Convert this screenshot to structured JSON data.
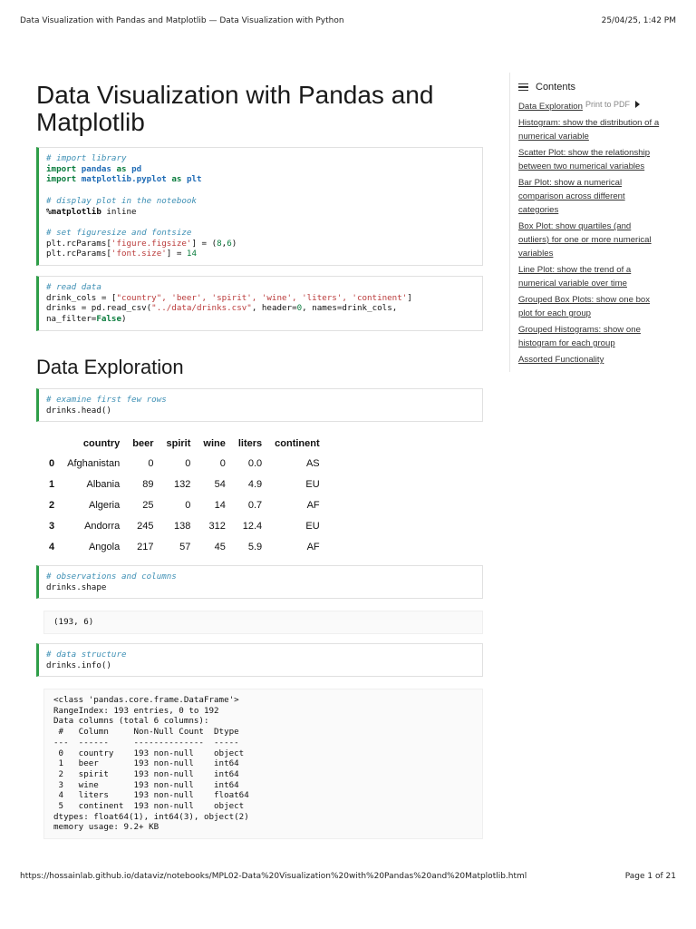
{
  "header": {
    "title": "Data Visualization with Pandas and Matplotlib — Data Visualization with Python",
    "datetime": "25/04/25, 1:42 PM"
  },
  "footer": {
    "url": "https://hossainlab.github.io/dataviz/notebooks/MPL02-Data%20Visualization%20with%20Pandas%20and%20Matplotlib.html",
    "page": "Page 1 of 21"
  },
  "page_title": "Data Visualization with Pandas and Matplotlib",
  "section_title": "Data Exploration",
  "cells": {
    "c1": {
      "comment1": "# import library",
      "kw_import": "import",
      "mod_pandas": "pandas",
      "kw_as": "as",
      "alias_pd": "pd",
      "mod_pyplot": "matplotlib.pyplot",
      "alias_plt": "plt",
      "comment2": "# display plot in the notebook",
      "magic": "%matplotlib",
      "magic_arg": " inline",
      "comment3": "# set figuresize and fontsize",
      "rc1_pre": "plt.rcParams[",
      "rc1_key": "'figure.figsize'",
      "rc1_mid": "] = (",
      "rc1_v1": "8",
      "rc1_comma": ",",
      "rc1_v2": "6",
      "rc1_end": ")",
      "rc2_pre": "plt.rcParams[",
      "rc2_key": "'font.size'",
      "rc2_mid": "] = ",
      "rc2_val": "14"
    },
    "c2": {
      "comment": "# read data",
      "line1_pre": "drink_cols = [",
      "line1_strings": "\"country\", 'beer', 'spirit', 'wine', 'liters', 'continent'",
      "line1_end": "]",
      "line2_pre": "drinks = pd.read_csv(",
      "line2_path": "\"../data/drinks.csv\"",
      "line2_mid": ", header=",
      "line2_zero": "0",
      "line2_end": ", names=drink_cols,",
      "line3_pre": "na_filter=",
      "line3_false": "False",
      "line3_end": ")"
    },
    "c3": {
      "comment": "# examine first few rows",
      "code": "drinks.head()"
    },
    "c4": {
      "comment": "# observations and columns",
      "code": "drinks.shape"
    },
    "c5": {
      "comment": "# data structure",
      "code": "drinks.info()"
    }
  },
  "table": {
    "columns": [
      "country",
      "beer",
      "spirit",
      "wine",
      "liters",
      "continent"
    ],
    "rows": [
      {
        "idx": "0",
        "cells": [
          "Afghanistan",
          "0",
          "0",
          "0",
          "0.0",
          "AS"
        ]
      },
      {
        "idx": "1",
        "cells": [
          "Albania",
          "89",
          "132",
          "54",
          "4.9",
          "EU"
        ]
      },
      {
        "idx": "2",
        "cells": [
          "Algeria",
          "25",
          "0",
          "14",
          "0.7",
          "AF"
        ]
      },
      {
        "idx": "3",
        "cells": [
          "Andorra",
          "245",
          "138",
          "312",
          "12.4",
          "EU"
        ]
      },
      {
        "idx": "4",
        "cells": [
          "Angola",
          "217",
          "57",
          "45",
          "5.9",
          "AF"
        ]
      }
    ]
  },
  "shape_output": "(193, 6)",
  "info_output": [
    "<class 'pandas.core.frame.DataFrame'>",
    "RangeIndex: 193 entries, 0 to 192",
    "Data columns (total 6 columns):",
    " #   Column     Non-Null Count  Dtype  ",
    "---  ------     --------------  -----  ",
    " 0   country    193 non-null    object ",
    " 1   beer       193 non-null    int64  ",
    " 2   spirit     193 non-null    int64  ",
    " 3   wine       193 non-null    int64  ",
    " 4   liters     193 non-null    float64",
    " 5   continent  193 non-null    object ",
    "dtypes: float64(1), int64(3), object(2)",
    "memory usage: 9.2+ KB"
  ],
  "toc": {
    "heading": "Contents",
    "print_label": "Print to PDF",
    "items": [
      "Data Exploration",
      "Histogram: show the distribution of a numerical variable",
      "Scatter Plot: show the relationship between two numerical variables",
      "Bar Plot: show a numerical comparison across different categories",
      "Box Plot: show quartiles (and outliers) for one or more numerical variables",
      "Line Plot: show the trend of a numerical variable over time",
      "Grouped Box Plots: show one box plot for each group",
      "Grouped Histograms: show one histogram for each group",
      "Assorted Functionality"
    ]
  },
  "colors": {
    "cell_border_accent": "#2e9e48",
    "comment": "#3d8fb4",
    "keyword": "#0b7d3e",
    "module": "#1f6bb5",
    "string": "#ba3b3b"
  }
}
